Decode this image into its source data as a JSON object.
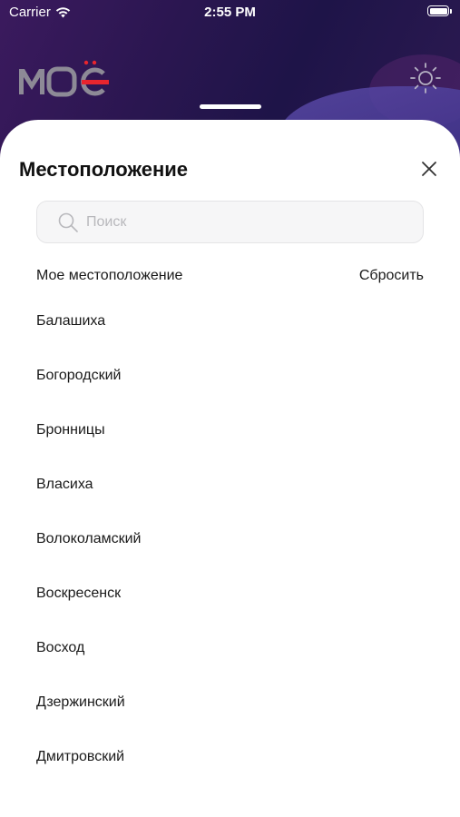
{
  "status_bar": {
    "carrier": "Carrier",
    "time": "2:55 PM"
  },
  "header": {
    "logo_text": "МОЁ",
    "logo_icon": "moe-logo",
    "theme_icon": "sun-icon"
  },
  "sheet": {
    "title": "Местоположение",
    "close_icon": "close-icon",
    "search": {
      "placeholder": "Поиск",
      "value": ""
    },
    "my_location_label": "Мое местоположение",
    "reset_label": "Сбросить",
    "locations": [
      "Балашиха",
      "Богородский",
      "Бронницы",
      "Власиха",
      "Волоколамский",
      "Воскресенск",
      "Восход",
      "Дзержинский",
      "Дмитровский"
    ]
  },
  "colors": {
    "header_gradient_start": "#3b1a5e",
    "header_gradient_end": "#1e1448",
    "logo_accent": "#e8252e",
    "search_bg": "#f6f6f7",
    "text_primary": "#1a1a1a",
    "placeholder": "#b8b8bc"
  }
}
